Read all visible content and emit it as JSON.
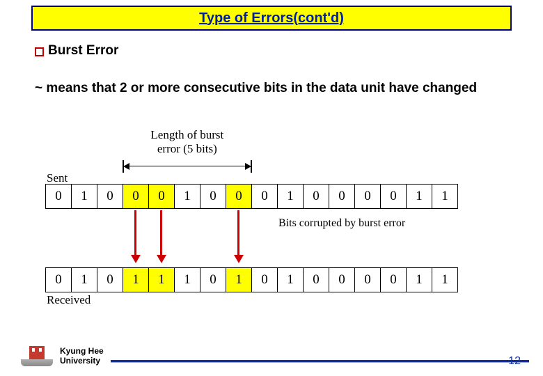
{
  "slide": {
    "title": "Type of Errors(cont'd)",
    "bullet": "Burst Error",
    "description": "~ means that 2 or more consecutive bits in the data unit have changed"
  },
  "diagram": {
    "length_label_line1": "Length of burst",
    "length_label_line2": "error (5 bits)",
    "sent_label": "Sent",
    "received_label": "Received",
    "corrupted_label": "Bits corrupted by burst error",
    "sent_bits": [
      "0",
      "1",
      "0",
      "0",
      "0",
      "1",
      "0",
      "0",
      "0",
      "1",
      "0",
      "0",
      "0",
      "0",
      "1",
      "1"
    ],
    "received_bits": [
      "0",
      "1",
      "0",
      "1",
      "1",
      "1",
      "0",
      "1",
      "0",
      "1",
      "0",
      "0",
      "0",
      "0",
      "1",
      "1"
    ],
    "highlight_sent_idx": [
      3,
      4,
      7
    ],
    "highlight_recv_idx": [
      3,
      4,
      7
    ],
    "arrow_idx": [
      3,
      4,
      7
    ],
    "burst_span": {
      "start_idx": 3,
      "end_idx": 7
    }
  },
  "footer": {
    "university_line1": "Kyung Hee",
    "university_line2": "University",
    "page_number": "12"
  }
}
